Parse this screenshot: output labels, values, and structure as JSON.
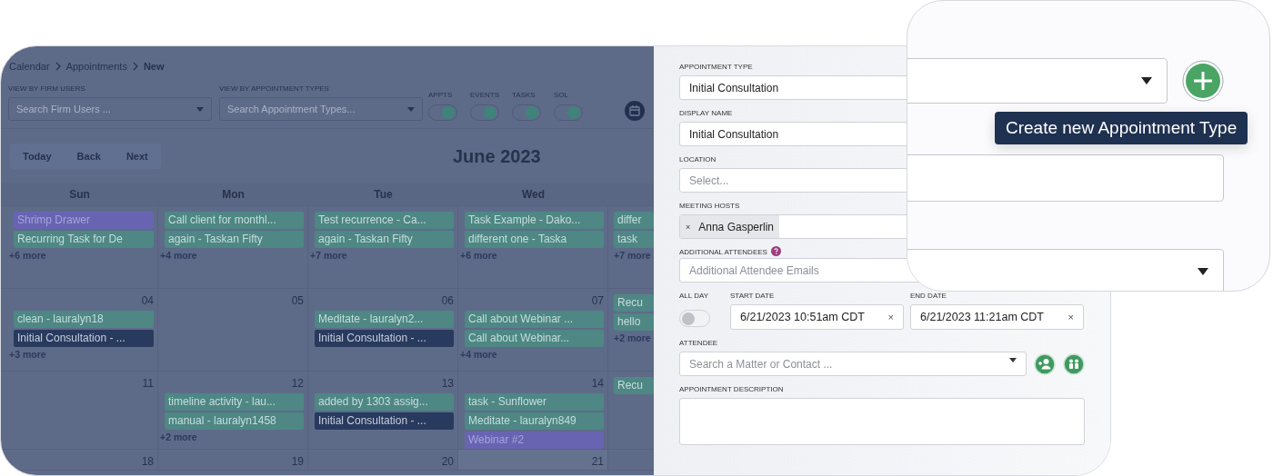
{
  "calendar": {
    "breadcrumb": [
      {
        "label": "Calendar",
        "current": false
      },
      {
        "label": "Appointments",
        "current": false
      },
      {
        "label": "New",
        "current": true
      }
    ],
    "filters": [
      {
        "label": "VIEW BY FIRM USERS",
        "placeholder": "Search Firm Users ..."
      },
      {
        "label": "VIEW BY APPOINTMENT TYPES",
        "placeholder": "Search Appointment Types..."
      }
    ],
    "toggles": [
      {
        "label": "APPTS",
        "on": true
      },
      {
        "label": "EVENTS",
        "on": true
      },
      {
        "label": "TASKS",
        "on": true
      },
      {
        "label": "SOL",
        "on": true
      }
    ],
    "nav_buttons": [
      "Today",
      "Back",
      "Next"
    ],
    "month": "June 2023",
    "weekdays": [
      "Sun",
      "Mon",
      "Tue",
      "Wed"
    ],
    "weeks": [
      {
        "days": [
          {
            "events": [
              {
                "title": "Shrimp Drawer",
                "kind": "event"
              },
              {
                "title": "Recurring Task for De",
                "kind": "task"
              }
            ],
            "more": "+6 more"
          },
          {
            "events": [
              {
                "title": "Call client for monthl...",
                "kind": "task"
              },
              {
                "title": "again - Taskan Fifty",
                "kind": "task"
              }
            ],
            "more": "+4 more"
          },
          {
            "events": [
              {
                "title": "Test recurrence - Ca...",
                "kind": "task"
              },
              {
                "title": "again - Taskan Fifty",
                "kind": "task"
              }
            ],
            "more": "+7 more"
          },
          {
            "events": [
              {
                "title": "Task Example - Dako...",
                "kind": "task"
              },
              {
                "title": "different one - Taska",
                "kind": "task"
              }
            ],
            "more": "+6 more"
          },
          {
            "events": [
              {
                "title": "differ",
                "kind": "task"
              },
              {
                "title": "task",
                "kind": "task"
              }
            ],
            "more": "+7 more"
          }
        ]
      },
      {
        "days": [
          {
            "date": "04",
            "events": [
              {
                "title": "clean - lauralyn18",
                "kind": "task"
              },
              {
                "title": "Initial Consultation - ...",
                "kind": "appointment"
              }
            ],
            "more": "+3 more"
          },
          {
            "date": "05"
          },
          {
            "date": "06",
            "events": [
              {
                "title": "Meditate - lauralyn2...",
                "kind": "task"
              },
              {
                "title": "Initial Consultation - ...",
                "kind": "appointment"
              }
            ]
          },
          {
            "date": "07",
            "events": [
              {
                "title": "Call about Webinar ...",
                "kind": "task"
              },
              {
                "title": "Call about Webinar...",
                "kind": "task"
              }
            ],
            "more": "+4 more"
          },
          {
            "events": [
              {
                "title": "Recu",
                "kind": "task"
              },
              {
                "title": "hello",
                "kind": "task"
              }
            ],
            "more": "+2 more"
          }
        ]
      },
      {
        "days": [
          {
            "date": "11"
          },
          {
            "date": "12",
            "events": [
              {
                "title": "timeline activity - lau...",
                "kind": "task"
              },
              {
                "title": "manual - lauralyn1458",
                "kind": "task"
              }
            ],
            "more": "+2 more"
          },
          {
            "date": "13",
            "events": [
              {
                "title": "added by 1303 assig...",
                "kind": "task"
              },
              {
                "title": "Initial Consultation - ...",
                "kind": "appointment"
              }
            ]
          },
          {
            "date": "14",
            "events": [
              {
                "title": "task - Sunflower",
                "kind": "task"
              },
              {
                "title": "Meditate - lauralyn849",
                "kind": "task"
              },
              {
                "title": "Webinar #2",
                "kind": "event"
              }
            ]
          },
          {
            "events": [
              {
                "title": "Recu",
                "kind": "task"
              }
            ]
          }
        ]
      },
      {
        "days": [
          {
            "date": "18"
          },
          {
            "date": "19"
          },
          {
            "date": "20"
          },
          {
            "date": "21",
            "today": true
          }
        ]
      }
    ]
  },
  "form": {
    "appointment_type": {
      "label": "APPOINTMENT TYPE",
      "value": "Initial Consultation"
    },
    "display_name": {
      "label": "DISPLAY NAME",
      "value": "Initial Consultation"
    },
    "location": {
      "label": "LOCATION",
      "placeholder": "Select..."
    },
    "meeting_hosts": {
      "label": "MEETING HOSTS",
      "chips": [
        {
          "remove": "×",
          "name": "Anna Gasperlin"
        }
      ]
    },
    "additional_attendees": {
      "label": "ADDITIONAL ATTENDEES",
      "placeholder": "Additional Attendee Emails"
    },
    "all_day": {
      "label": "ALL DAY",
      "on": false
    },
    "start_date": {
      "label": "START DATE",
      "value": "6/21/2023 10:51am CDT",
      "clear": "×"
    },
    "end_date": {
      "label": "END DATE",
      "value": "6/21/2023 11:21am CDT",
      "clear": "×"
    },
    "attendee": {
      "label": "ATTENDEE",
      "placeholder": "Search a Matter or Contact ..."
    },
    "description": {
      "label": "APPOINTMENT DESCRIPTION"
    }
  },
  "zoom_panel": {
    "tooltip": "Create new Appointment Type"
  }
}
